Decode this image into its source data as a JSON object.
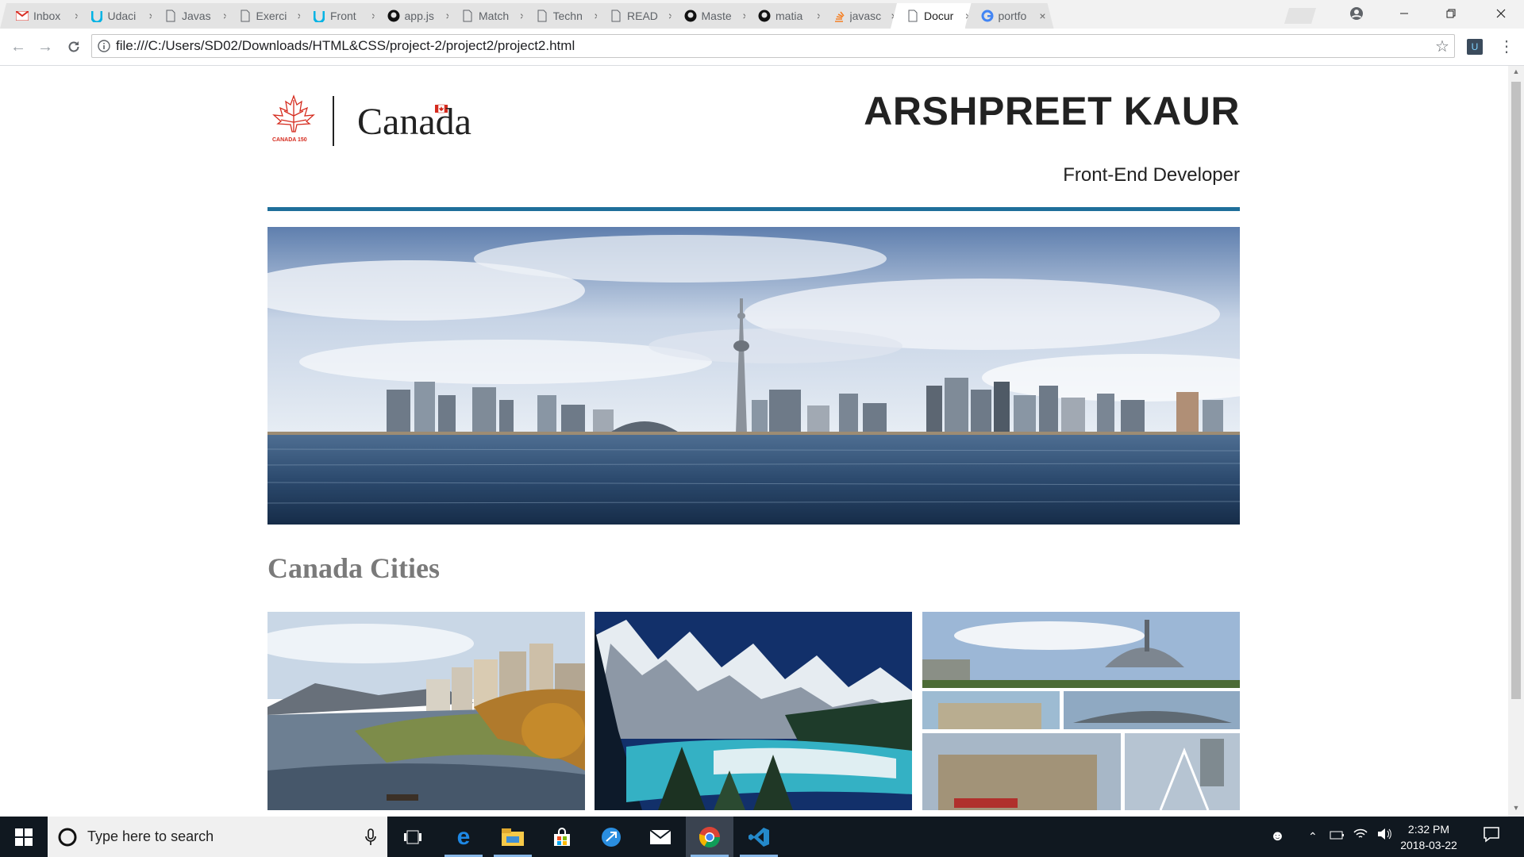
{
  "browser": {
    "tabs": [
      {
        "label": "Inbox",
        "icon": "gmail-icon"
      },
      {
        "label": "Udaci",
        "icon": "udacity-icon"
      },
      {
        "label": "Javas",
        "icon": "page-icon"
      },
      {
        "label": "Exerci",
        "icon": "page-icon"
      },
      {
        "label": "Front",
        "icon": "udacity-icon"
      },
      {
        "label": "app.js",
        "icon": "github-icon"
      },
      {
        "label": "Match",
        "icon": "page-icon"
      },
      {
        "label": "Techn",
        "icon": "page-icon"
      },
      {
        "label": "READ",
        "icon": "page-icon"
      },
      {
        "label": "Maste",
        "icon": "github-icon"
      },
      {
        "label": "matia",
        "icon": "github-icon"
      },
      {
        "label": "javasc",
        "icon": "stackoverflow-icon"
      },
      {
        "label": "Docur",
        "icon": "page-icon"
      },
      {
        "label": "portfo",
        "icon": "google-icon"
      }
    ],
    "active_tab": 12,
    "address": {
      "url": "file:///C:/Users/SD02/Downloads/HTML&CSS/project-2/project2/project2.html"
    }
  },
  "page": {
    "logo": {
      "wordmark": "Canada",
      "caption": "CANADA 150"
    },
    "name": "ARSHPREET KAUR",
    "role": "Front-End Developer",
    "section_title": "Canada Cities",
    "colors": {
      "rule": "#1f6f9a",
      "logo_red": "#d52b1e",
      "section_title": "#7a7a7a"
    }
  },
  "taskbar": {
    "search_placeholder": "Type here to search",
    "time": "2:32 PM",
    "date": "2018-03-22",
    "apps": [
      "task-view-icon",
      "edge-icon",
      "file-explorer-icon",
      "store-icon",
      "network-app-icon",
      "mail-icon",
      "chrome-icon",
      "vscode-icon"
    ]
  }
}
